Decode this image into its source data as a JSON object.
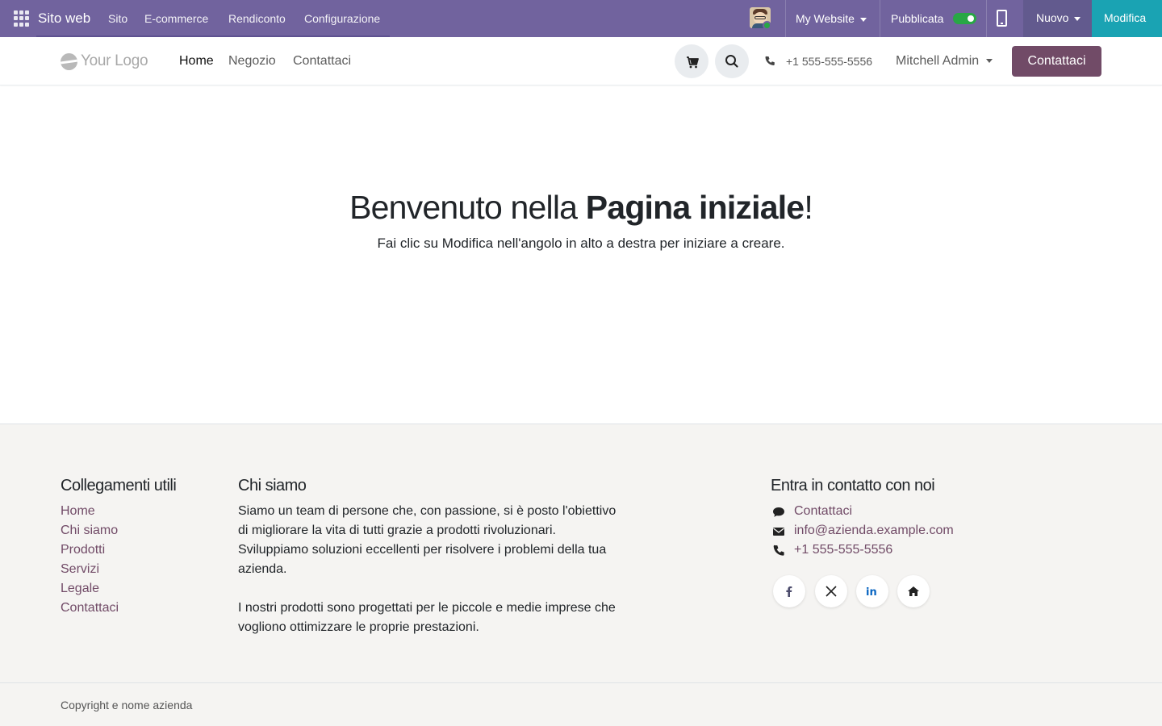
{
  "admin_bar": {
    "app_name": "Sito web",
    "menu": [
      "Sito",
      "E-commerce",
      "Rendiconto",
      "Configurazione"
    ],
    "website_selector": "My Website",
    "published_label": "Pubblicata",
    "published": true,
    "new_label": "Nuovo",
    "edit_label": "Modifica",
    "colors": {
      "bar": "#71639e",
      "new": "#625a8e",
      "edit": "#1aa3b3"
    }
  },
  "site_header": {
    "logo_text": "Your Logo",
    "nav": [
      "Home",
      "Negozio",
      "Contattaci"
    ],
    "active_nav": "Home",
    "phone": "+1 555-555-5556",
    "user": "Mitchell Admin",
    "contact_button": "Contattaci",
    "icons": [
      "shopping-cart-icon",
      "search-icon",
      "phone-icon"
    ],
    "accent": "#714b67"
  },
  "hero": {
    "title_prefix": "Benvenuto nella ",
    "title_bold": "Pagina iniziale",
    "title_suffix": "!",
    "subtitle": "Fai clic su Modifica nell'angolo in alto a destra per iniziare a creare."
  },
  "footer": {
    "useful_links": {
      "title": "Collegamenti utili",
      "items": [
        "Home",
        "Chi siamo",
        "Prodotti",
        "Servizi",
        "Legale",
        "Contattaci"
      ]
    },
    "about": {
      "title": "Chi siamo",
      "para1": [
        "Siamo un team di persone che, con passione, si è posto l'obiettivo",
        "di migliorare la vita di tutti grazie a prodotti rivoluzionari.",
        "Sviluppiamo soluzioni eccellenti per risolvere i problemi della tua",
        "azienda."
      ],
      "para2": [
        "I nostri prodotti sono progettati per le piccole e medie imprese che",
        "vogliono ottimizzare le proprie prestazioni."
      ]
    },
    "contact": {
      "title": "Entra in contatto con noi",
      "items": [
        "Contattaci",
        "info@azienda.example.com",
        "+1 555-555-5556"
      ],
      "social": [
        "facebook-icon",
        "x-twitter-icon",
        "linkedin-icon",
        "home-icon"
      ]
    },
    "copyright": "Copyright e nome azienda"
  }
}
